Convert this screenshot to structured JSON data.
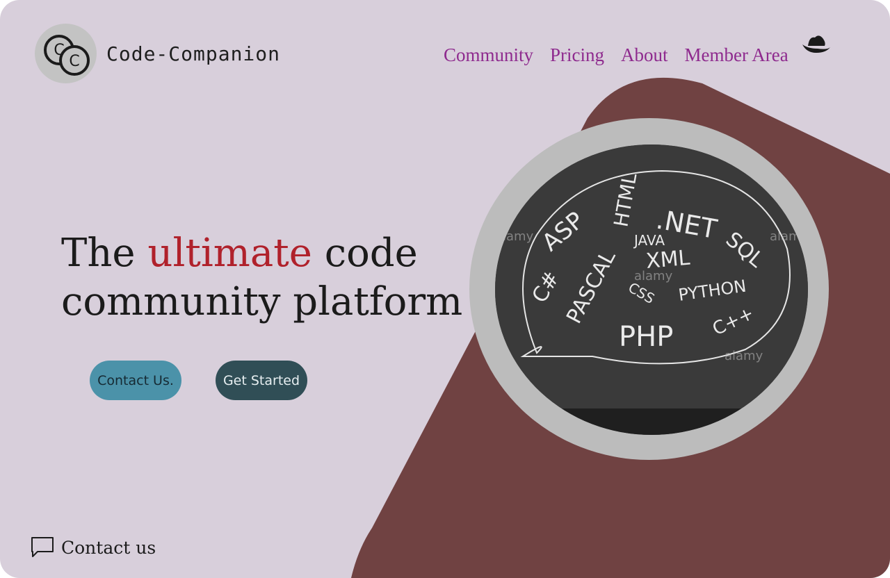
{
  "brand": {
    "name": "Code-Companion",
    "logo_icon": "double-c-logo-icon",
    "logo_letters": [
      "C",
      "C"
    ]
  },
  "nav": {
    "items": [
      {
        "label": "Community"
      },
      {
        "label": "Pricing"
      },
      {
        "label": "About"
      },
      {
        "label": "Member Area"
      }
    ],
    "member_icon": "hat-icon"
  },
  "hero": {
    "headline_before": "The",
    "headline_accent": "ultimate",
    "headline_after": "code community platform",
    "contact_button": "Contact Us.",
    "start_button": "Get Started"
  },
  "image": {
    "bubble_words": [
      ".NET",
      "ASP",
      "HTML",
      "SQL",
      "JAVA",
      "XML",
      "PASCAL",
      "C#",
      "CSS",
      "PYTHON",
      "PHP",
      "C++"
    ],
    "watermark": "alamy"
  },
  "footer": {
    "contact_label": "Contact us",
    "contact_icon": "chat-bubble-icon"
  },
  "colors": {
    "background": "#d8cfdb",
    "shape": "#704242",
    "nav_link": "#8e2a8e",
    "accent_word": "#b0212b",
    "contact_button": "#4b92a9",
    "start_button": "#304e56"
  }
}
